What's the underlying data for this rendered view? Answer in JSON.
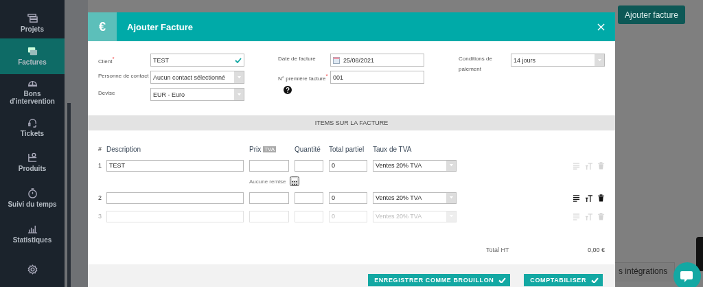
{
  "sidebar": {
    "items": [
      {
        "label": "Projets",
        "selected": false
      },
      {
        "label": "Factures",
        "selected": true
      },
      {
        "label": "Bons d'intervention",
        "selected": false
      },
      {
        "label": "Tickets",
        "selected": false
      },
      {
        "label": "Produits",
        "selected": false
      },
      {
        "label": "Suivi du temps",
        "selected": false
      },
      {
        "label": "Statistiques",
        "selected": false
      },
      {
        "selected": false
      }
    ]
  },
  "page": {
    "add_button": "Ajouter facture",
    "tab": "s intégrations"
  },
  "dialog": {
    "symbol": "€",
    "title": "Ajouter Facture",
    "field_groups": [
      {
        "fields": [
          {
            "label": "Client$^{*}$",
            "value": "TEST",
            "kind": "valid"
          },
          {
            "label": "Personne de contact",
            "value": "Aucun contact sélectionné",
            "kind": "select"
          },
          {
            "label": "Devise",
            "value": "EUR - Euro",
            "kind": "select"
          }
        ]
      },
      {
        "fields": [
          {
            "label": "Date de facture",
            "value": "25/08/2021",
            "kind": "date"
          },
          {
            "label": "N° première facture$^{*}$",
            "value": "001",
            "kind": "help"
          }
        ]
      },
      {
        "fields": [
          {
            "label": "Conditions de paiement",
            "value": "14 jours",
            "kind": "select"
          }
        ]
      }
    ],
    "section": "ITEMS SUR LA FACTURE",
    "columns": {
      "number": "#",
      "description": "Description",
      "price": "Prix",
      "price_badge": "TVA",
      "quantity": "Quantité",
      "total": "Total partiel",
      "vat": "Taux de TVA"
    },
    "rows": [
      {
        "number": "1",
        "description": "TEST",
        "total": "0",
        "vat": "Ventes 20% TVA",
        "disabled": false,
        "actions_enabled": false,
        "discount": "Aucune remise"
      },
      {
        "number": "2",
        "description": "",
        "total": "0",
        "vat": "Ventes 20% TVA",
        "disabled": false,
        "actions_enabled": true
      },
      {
        "number": "3",
        "description": "",
        "total": "0",
        "vat": "Ventes 20% TVA",
        "disabled": true,
        "actions_enabled": false
      }
    ],
    "total_label": "Total HT",
    "total_value": "0,00 €",
    "buttons": [
      "ENREGISTRER COMME BROUILLON",
      "COMPTABILISER"
    ]
  }
}
